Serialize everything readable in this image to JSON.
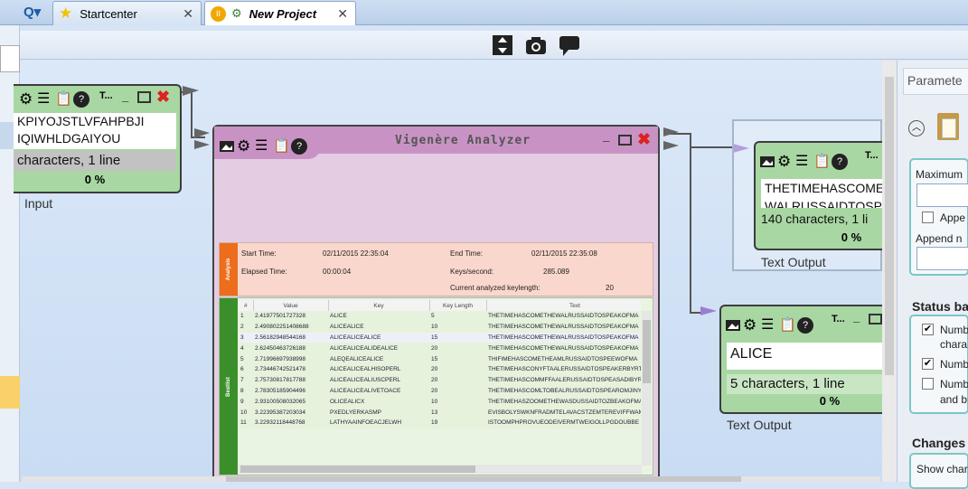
{
  "tabs": [
    {
      "label": "Startcenter",
      "icon": "star-icon"
    },
    {
      "label": "New Project",
      "icon": "project-icon"
    }
  ],
  "toolbar": {
    "icons": [
      "fit-view-icon",
      "screenshot-icon",
      "comment-icon"
    ]
  },
  "input_comp": {
    "text_line1": "KPIYOJSTLVFAHPBJI",
    "text_line2": "IQIWHLDGAIYOU",
    "status": "characters,  1 line",
    "percent": "0 %",
    "label": "Input",
    "title": "T..."
  },
  "analyzer": {
    "title": "Vigenère Analyzer",
    "stats_section": "Analysis",
    "start_time_label": "Start Time:",
    "start_time": "02/11/2015 22:35:04",
    "end_time_label": "End Time:",
    "end_time": "02/11/2015 22:35:08",
    "elapsed_label": "Elapsed Time:",
    "elapsed": "00:00:04",
    "keys_label": "Keys/second:",
    "keys": "285.089",
    "keylen_label": "Current analyzed keylength:",
    "keylen": "20",
    "bestlist_section": "Bestlist",
    "columns": [
      "#",
      "Value",
      "Key",
      "Key Length",
      "Text"
    ],
    "rows": [
      [
        "1",
        "2.41977501727328",
        "ALICE",
        "5",
        "THETIMEHASCOMETHEWALRUSSAIDTOSPEAKOFMA"
      ],
      [
        "2",
        "2.490802251408688",
        "ALICEALICE",
        "10",
        "THETIMEHASCOMETHEWALRUSSAIDTOSPEAKOFMA"
      ],
      [
        "3",
        "2.56182948544168",
        "ALICEALICEALICE",
        "15",
        "THETIMEHASCOMETHEWALRUSSAIDTOSPEAKOFMA"
      ],
      [
        "4",
        "2.62450463726188",
        "ALICEALICEALIDEALICE",
        "20",
        "THETIMEHASCOMETHEWALRUSSAIDTOSPEAKOFMA"
      ],
      [
        "5",
        "2.71996697938998",
        "ALEQEALICEALICE",
        "15",
        "THIFIMEHASCOMETHEAMLRUSSAIDTOSPEEWOFMA"
      ],
      [
        "6",
        "2.73446742521478",
        "ALICEALICEALHISOPERL",
        "20",
        "THETIMEHASCONYFTAALERUSSAIDTOSPEAKERBYRT"
      ],
      [
        "7",
        "2.75730817817788",
        "ALICEALICEALIUSCPERL",
        "20",
        "THETIMEHASCOMMFFAALERUSSAIDTOSPEASADIBYR"
      ],
      [
        "8",
        "2.78305185904496",
        "ALICEALICEALIVETOACE",
        "20",
        "THETIMEHASCOMLTOBEALRUSSAIDTOSPEAROMJINY"
      ],
      [
        "9",
        "2.93100508032065",
        "OLICEALICX",
        "10",
        "THETIMEHASZOOMETHEWASDUSSAIDTOZBEAKOFMA"
      ],
      [
        "10",
        "3.22395387203034",
        "PXEDLYERKASMP",
        "13",
        "EVISBOLYSWKNFRADMTELAVACSTZEMTEREVIFFWAM"
      ],
      [
        "11",
        "3.22932118448768",
        "LATHYAAINFOEACJELWH",
        "19",
        "ISTOOMPHPROVUEODEIVERMTWEIGOLLPGDOUBBE"
      ]
    ]
  },
  "text_out1": {
    "line1": "THETIMEHASCOME",
    "line2": "WALRUSSAIDTOSPE",
    "status": "140 characters,  1 li",
    "percent": "0 %",
    "label": "Text Output",
    "title": "T..."
  },
  "text_out2": {
    "text": "ALICE",
    "status": "5 characters,  1 line",
    "percent": "0 %",
    "label": "Text Output",
    "title": "T..."
  },
  "panel": {
    "title": "Paramete",
    "maximum": "Maximum",
    "append": "Appe",
    "append2": "Append n",
    "status_bar": "Status ba",
    "num1": "Numb",
    "num1b": "chara",
    "num2": "Numb",
    "num3": "Numb",
    "num3b": "and b",
    "changes": "Changes",
    "show": "Show char"
  }
}
